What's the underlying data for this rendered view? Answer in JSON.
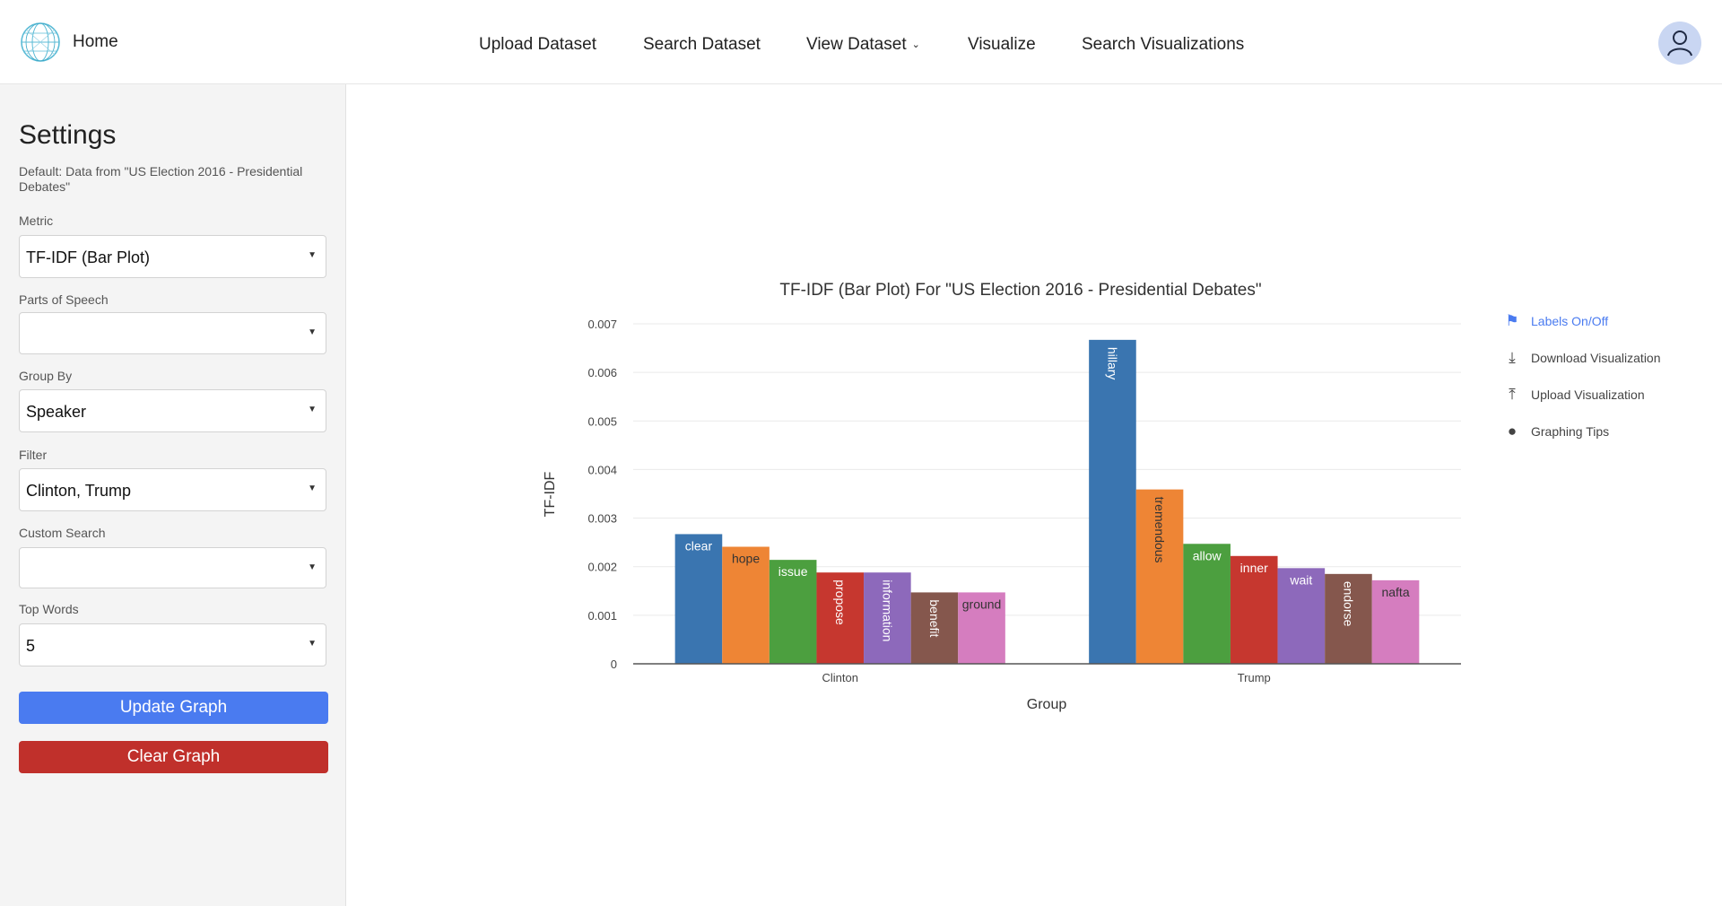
{
  "header": {
    "home_label": "Home",
    "nav": [
      "Upload Dataset",
      "Search Dataset",
      "View Dataset",
      "Visualize",
      "Search Visualizations"
    ]
  },
  "sidebar": {
    "title": "Settings",
    "description": "Default: Data from \"US Election 2016 - Presidential Debates\"",
    "fields": [
      {
        "label": "Metric",
        "value": "TF-IDF (Bar Plot)"
      },
      {
        "label": "Parts of Speech",
        "value": ""
      },
      {
        "label": "Group By",
        "value": "Speaker"
      },
      {
        "label": "Filter",
        "value": "Clinton, Trump"
      },
      {
        "label": "Custom Search",
        "value": ""
      },
      {
        "label": "Top Words",
        "value": "5"
      }
    ],
    "update_label": "Update Graph",
    "clear_label": "Clear Graph",
    "update_color": "#4a7bf0",
    "clear_color": "#c0302b"
  },
  "chart_tools": [
    {
      "label": "Labels On/Off",
      "icon": "tag-icon"
    },
    {
      "label": "Download Visualization",
      "icon": "download-icon"
    },
    {
      "label": "Upload Visualization",
      "icon": "upload-icon"
    },
    {
      "label": "Graphing Tips",
      "icon": "lightbulb-icon"
    }
  ],
  "chart_data": {
    "type": "bar",
    "title": "TF-IDF (Bar Plot) For \"US Election 2016 - Presidential Debates\"",
    "xlabel": "Group",
    "ylabel": "TF-IDF",
    "ylim": [
      0,
      0.007
    ],
    "yticks": [
      "0",
      "0.001",
      "0.002",
      "0.003",
      "0.004",
      "0.005",
      "0.006",
      "0.007"
    ],
    "grid": true,
    "groups": [
      {
        "name": "Clinton",
        "bars": [
          {
            "word": "clear",
            "value": 0.00267
          },
          {
            "word": "hope",
            "value": 0.00241
          },
          {
            "word": "issue",
            "value": 0.00214
          },
          {
            "word": "propose",
            "value": 0.00188
          },
          {
            "word": "information",
            "value": 0.00188
          },
          {
            "word": "benefit",
            "value": 0.00147
          },
          {
            "word": "ground",
            "value": 0.00147
          }
        ]
      },
      {
        "name": "Trump",
        "bars": [
          {
            "word": "hillary",
            "value": 0.00667
          },
          {
            "word": "tremendous",
            "value": 0.00359
          },
          {
            "word": "allow",
            "value": 0.00247
          },
          {
            "word": "inner",
            "value": 0.00222
          },
          {
            "word": "wait",
            "value": 0.00197
          },
          {
            "word": "endorse",
            "value": 0.00185
          },
          {
            "word": "nafta",
            "value": 0.00172
          }
        ]
      }
    ],
    "colors": [
      "#3a75b0",
      "#ee8535",
      "#4c9f3f",
      "#c6372f",
      "#8d69bb",
      "#85574d",
      "#d57dbf"
    ]
  }
}
